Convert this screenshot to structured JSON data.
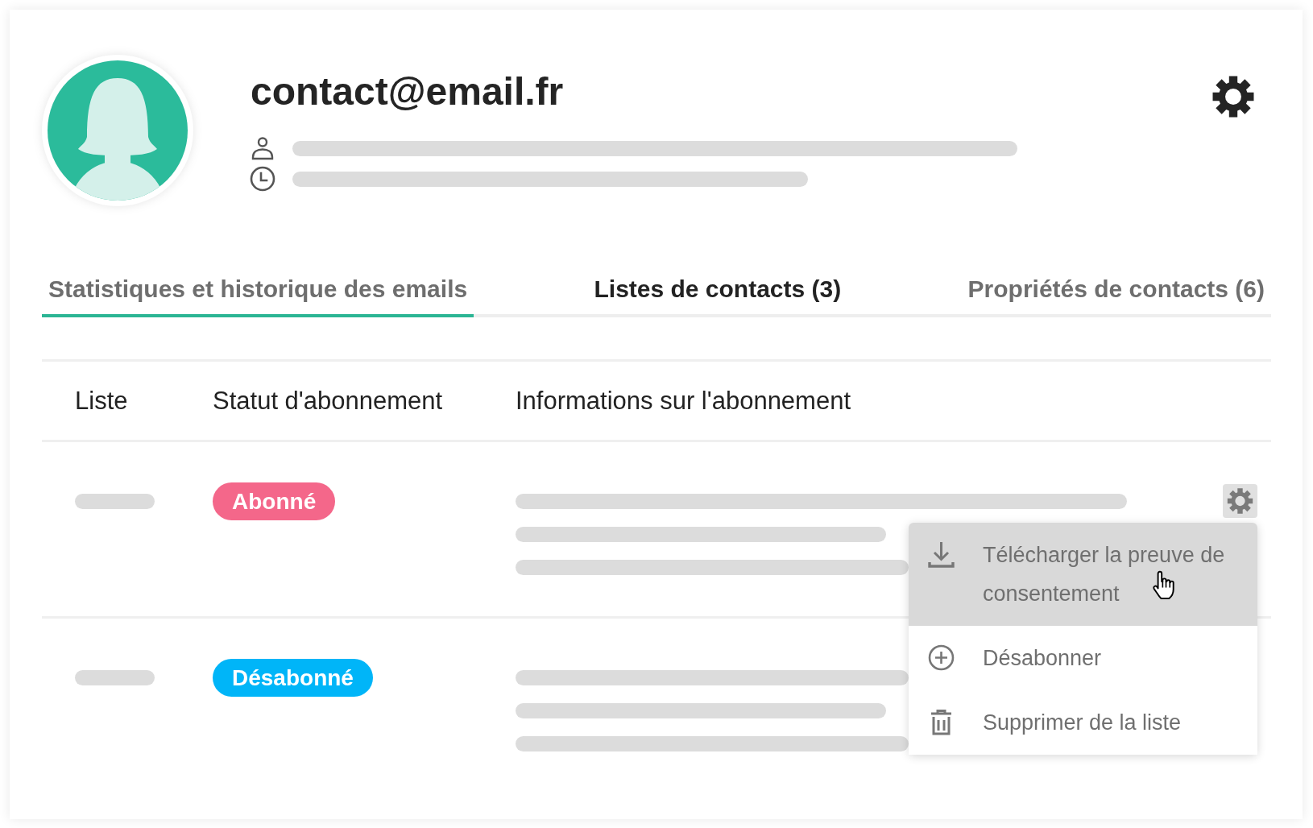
{
  "profile": {
    "email": "contact@email.fr"
  },
  "tabs": [
    {
      "label": "Statistiques et historique des emails",
      "selected": false,
      "underlined": true
    },
    {
      "label": "Listes de contacts (3)",
      "selected": true,
      "underlined": false
    },
    {
      "label": "Propriétés de contacts (6)",
      "selected": false,
      "underlined": false
    }
  ],
  "table": {
    "columns": [
      "Liste",
      "Statut d'abonnement",
      "Informations sur l'abonnement"
    ],
    "rows": [
      {
        "status": {
          "label": "Abonné",
          "color": "#f4678a"
        },
        "menu_open": true
      },
      {
        "status": {
          "label": "Désabonné",
          "color": "#00b5f8"
        },
        "menu_open": false
      }
    ]
  },
  "row_menu": {
    "items": [
      {
        "kind": "download",
        "label": "Télécharger la preuve de consentement",
        "highlighted": true
      },
      {
        "kind": "unsubscribe",
        "label": "Désabonner",
        "highlighted": false
      },
      {
        "kind": "remove",
        "label": "Supprimer de la liste",
        "highlighted": false
      }
    ]
  }
}
